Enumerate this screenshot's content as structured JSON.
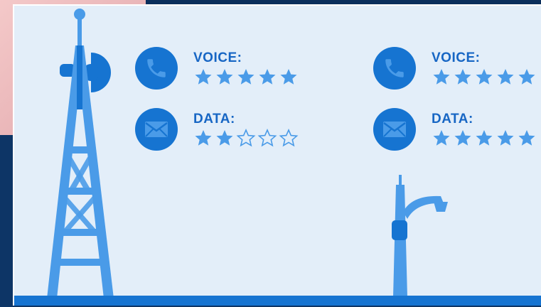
{
  "colors": {
    "panel_bg": "#e3eef9",
    "accent": "#1674d1",
    "accent_light": "#4a9be8",
    "text": "#1766c4"
  },
  "left_site": {
    "voice": {
      "label": "VOICE:",
      "rating": 5,
      "max": 5,
      "icon": "phone-icon"
    },
    "data": {
      "label": "DATA:",
      "rating": 2,
      "max": 5,
      "icon": "envelope-icon"
    }
  },
  "right_site": {
    "voice": {
      "label": "VOICE:",
      "rating": 5,
      "max": 5,
      "icon": "phone-icon"
    },
    "data": {
      "label": "DATA:",
      "rating": 5,
      "max": 5,
      "icon": "envelope-icon"
    }
  },
  "illustrations": {
    "left": "cell-tower-icon",
    "right": "street-lamp-small-cell-icon"
  }
}
